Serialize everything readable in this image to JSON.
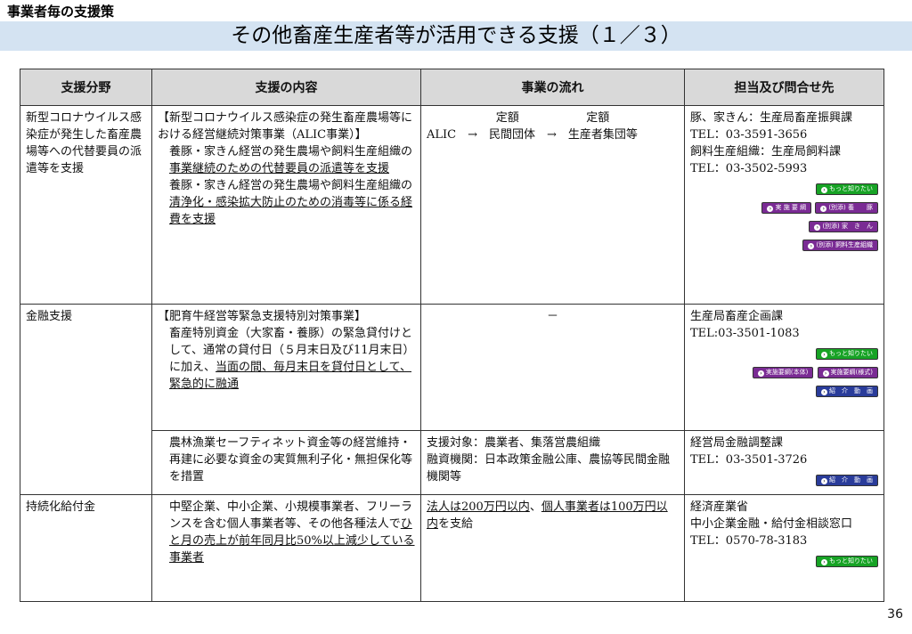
{
  "section_label": "事業者毎の支援策",
  "page_title": "その他畜産生産者等が活用できる支援（１／３）",
  "headers": [
    "支援分野",
    "支援の内容",
    "事業の流れ",
    "担当及び問合せ先"
  ],
  "rows": {
    "r1": {
      "field": "新型コロナウイルス感染症が発生した畜産農場等への代替要員の派遣等を支援",
      "content": {
        "title": "【新型コロナウイルス感染症の発生畜産農場等における経営継続対策事業（ALIC事業）】",
        "p1_pre": "養豚・家きん経営の発生農場や飼料生産組織の",
        "p1_u": "事業継続のための代替要員の派遣等を支援",
        "p2_pre": "養豚・家きん経営の発生農場や飼料生産組織の",
        "p2_u": "清浄化・感染拡大防止のための消毒等に係る経費を支援"
      },
      "flow": {
        "label1": "定額",
        "label2": "定額",
        "line": "ALIC　→　民間団体　→　生産者集団等"
      },
      "contact": {
        "l1": "豚、家きん：生産局畜産振興課",
        "l2": "TEL：03-3591-3656",
        "l3": "飼料生産組織：生産局飼料課",
        "l4": "TEL：03-3502-5993"
      },
      "buttons": {
        "more": "もっと知りたい",
        "jisshi": "実 施 要 綱",
        "betten1": "(別添) 養　　豚",
        "betten2": "(別添) 家　き　ん",
        "betten3": "(別添) 飼料生産組織"
      }
    },
    "r2": {
      "field": "金融支援",
      "content": {
        "title": "【肥育牛経営等緊急支援特別対策事業】",
        "p1_pre": "畜産特別資金（大家畜・養豚）の緊急貸付けとして、通常の貸付日（５月末日及び11月末日）に加え、",
        "p1_u": "当面の間、毎月末日を貸付日として、緊急的に融通"
      },
      "flow": "－",
      "contact": {
        "l1": "生産局畜産企画課",
        "l2": "TEL:03-3501-1083"
      },
      "buttons": {
        "more": "もっと知りたい",
        "honntai": "実施要綱(本体)",
        "youshiki": "実施要綱(様式)",
        "video": "紹　介　動　画"
      }
    },
    "r3": {
      "content": "農林漁業セーフティネット資金等の経営維持・再建に必要な資金の実質無利子化・無担保化等を措置",
      "flow": {
        "l1": "支援対象：農業者、集落営農組織",
        "l2": "融資機関：日本政策金融公庫、農協等民間金融機関等"
      },
      "contact": {
        "l1": "経営局金融調整課",
        "l2": "TEL：03-3501-3726"
      },
      "buttons": {
        "video": "紹　介　動　画"
      }
    },
    "r4": {
      "field": "持続化給付金",
      "content": {
        "pre": "中堅企業、中小企業、小規模事業者、フリーランスを含む個人事業者等、その他各種法人で",
        "u": "ひと月の売上が前年同月比50%以上減少している事業者"
      },
      "flow": {
        "u1": "法人は200万円以内",
        "mid": "、",
        "u2": "個人事業者は100万円以内",
        "post": "を支給"
      },
      "contact": {
        "l1": "経済産業省",
        "l2": "中小企業金融・給付金相談窓口",
        "l3": "TEL：0570-78-3183"
      },
      "buttons": {
        "more": "もっと知りたい"
      }
    }
  },
  "page_number": "36"
}
